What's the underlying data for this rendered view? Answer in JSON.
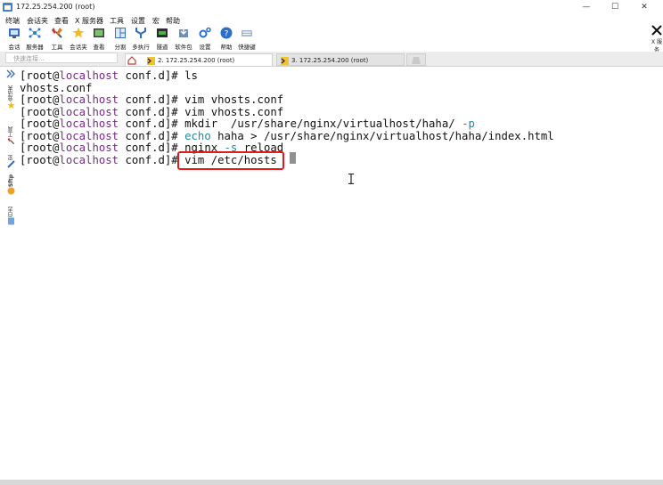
{
  "window": {
    "title": "172.25.254.200 (root)",
    "controls": [
      "—",
      "☐",
      "✕"
    ]
  },
  "menu": [
    "终端",
    "会话夹",
    "查看",
    "X 服务器",
    "工具",
    "设置",
    "宏",
    "帮助"
  ],
  "toolbar": [
    {
      "label": "会话",
      "icon": "session-icon"
    },
    {
      "label": "服务器",
      "icon": "servers-icon"
    },
    {
      "label": "工具",
      "icon": "tools-icon"
    },
    {
      "label": "会话夹",
      "icon": "star-icon"
    },
    {
      "label": "查看",
      "icon": "view-icon"
    },
    {
      "label": "分割",
      "icon": "split-icon"
    },
    {
      "label": "多执行",
      "icon": "multiexec-icon"
    },
    {
      "label": "隧道",
      "icon": "tunnel-icon"
    },
    {
      "label": "软件包",
      "icon": "package-icon"
    },
    {
      "label": "设置",
      "icon": "settings-icon"
    },
    {
      "label": "帮助",
      "icon": "help-icon"
    },
    {
      "label": "快捷键",
      "icon": "keyboard-icon"
    }
  ],
  "right_button": "X 服务",
  "quick_connect": {
    "placeholder": "快速连接..."
  },
  "tabs": [
    {
      "label": "2. 172.25.254.200 (root)",
      "active": true
    },
    {
      "label": "3. 172.25.254.200 (root)",
      "active": false
    }
  ],
  "sidebar": [
    "会话夹",
    "工具",
    "宏",
    "Sftp",
    "日志"
  ],
  "terminal": {
    "prompt_user": "[root@",
    "prompt_host": "localhost",
    "prompt_dir": " conf.d]# ",
    "lines": [
      {
        "type": "cmd",
        "cmd": "ls"
      },
      {
        "type": "out",
        "text": "vhosts.conf"
      },
      {
        "type": "cmd",
        "cmd": "vim vhosts.conf"
      },
      {
        "type": "cmd",
        "cmd": "vim vhosts.conf"
      },
      {
        "type": "cmd",
        "cmd": "mkdir  /usr/share/nginx/virtualhost/haha/ ",
        "opt": "-p"
      },
      {
        "type": "cmd",
        "kw": "echo",
        "cmd": " haha > /usr/share/nginx/virtualhost/haha/index.html"
      },
      {
        "type": "cmd",
        "cmd": "nginx ",
        "opt": "-s",
        "rest": " reload"
      },
      {
        "type": "cmd",
        "cmd": "vim /etc/hosts"
      }
    ]
  },
  "colors": {
    "host": "#7a2a8a",
    "keyword": "#1f8b9b",
    "highlight": "#e31b1b"
  }
}
